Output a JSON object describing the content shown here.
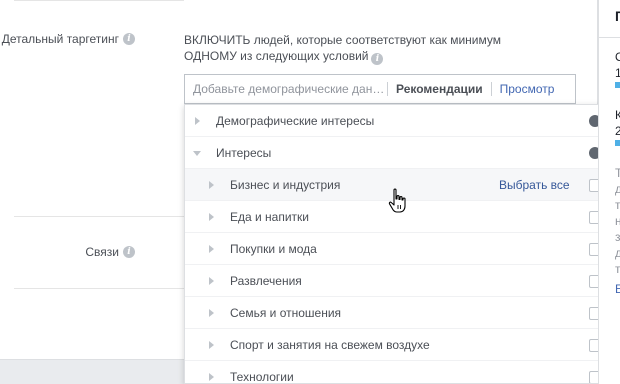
{
  "detailed_targeting": {
    "label": "Детальный таргетинг",
    "description": "ВКЛЮЧИТЬ людей, которые соответствуют как минимум ОДНОМУ из следующих условий",
    "search_placeholder": "Добавьте демографические дан…",
    "recommendations_label": "Рекомендации",
    "browse_label": "Просмотр"
  },
  "connections": {
    "label": "Связи"
  },
  "dropdown": {
    "top_categories": [
      {
        "label": "Демографические интересы",
        "expanded": false
      },
      {
        "label": "Интересы",
        "expanded": true
      }
    ],
    "select_all_label": "Выбрать все",
    "subcategories": [
      {
        "label": "Бизнес и индустрия"
      },
      {
        "label": "Еда и напитки"
      },
      {
        "label": "Покупки и мода"
      },
      {
        "label": "Развлечения"
      },
      {
        "label": "Семья и отношения"
      },
      {
        "label": "Спорт и занятия на свежем воздухе"
      },
      {
        "label": "Технологии"
      }
    ]
  },
  "right_column": {
    "chars": [
      "П",
      "О",
      "1",
      "К",
      "2",
      "Т",
      "д",
      "т",
      "н",
      "з",
      "д",
      "т",
      "Е"
    ]
  },
  "colors": {
    "link": "#4267b2",
    "select_all": "#365899",
    "bar": "#4fb0e6"
  }
}
